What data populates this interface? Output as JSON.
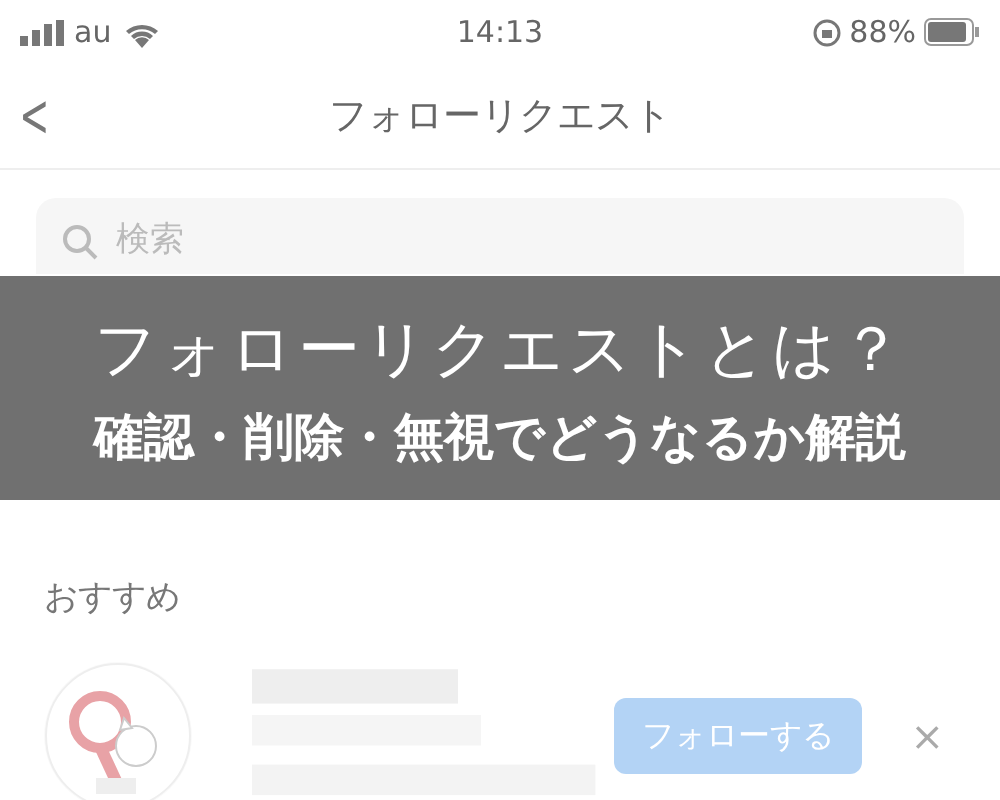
{
  "status_bar": {
    "carrier": "au",
    "time": "14:13",
    "battery": "88%"
  },
  "nav": {
    "back": "<",
    "title": "フォローリクエスト"
  },
  "search": {
    "placeholder": "検索"
  },
  "banner": {
    "title": "フォローリクエストとは？",
    "subtitle": "確認・削除・無視でどうなるか解説"
  },
  "suggestions": {
    "heading": "おすすめ",
    "items": [
      {
        "kind": "picture",
        "button": "フォローする",
        "dismiss": "×"
      }
    ]
  }
}
